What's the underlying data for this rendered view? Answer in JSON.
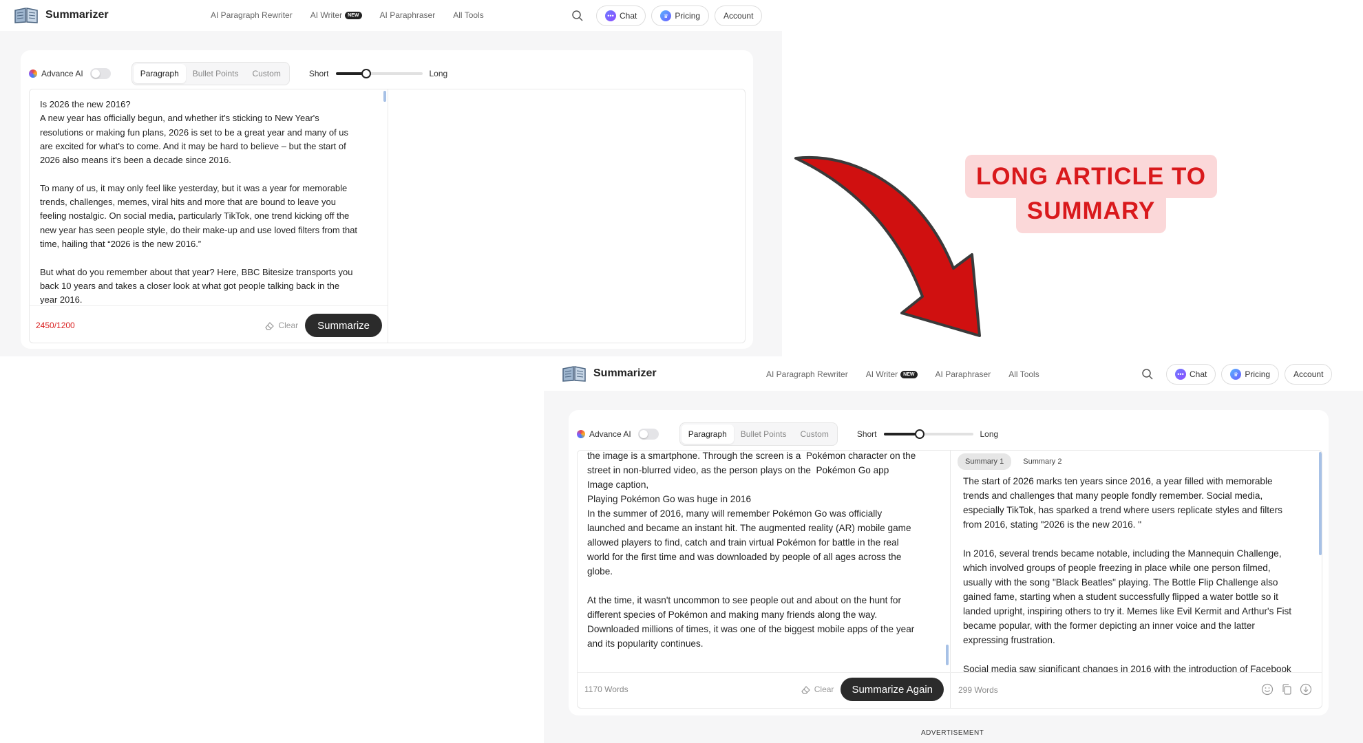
{
  "brand": {
    "name": "Summarizer"
  },
  "nav": {
    "links": [
      "AI Paragraph Rewriter",
      "AI Writer",
      "AI Paraphraser",
      "All Tools"
    ],
    "new_badge": "NEW",
    "chat": "Chat",
    "pricing": "Pricing",
    "account": "Account"
  },
  "toolbar": {
    "advance_ai": "Advance AI",
    "modes": [
      "Paragraph",
      "Bullet Points",
      "Custom"
    ],
    "short": "Short",
    "long": "Long"
  },
  "before": {
    "input_text": "Is 2026 the new 2016?\nA new year has officially begun, and whether it's sticking to New Year's\nresolutions or making fun plans, 2026 is set to be a great year and many of us\nare excited for what's to come. And it may be hard to believe – but the start of\n2026 also means it's been a decade since 2016.\n\nTo many of us, it may only feel like yesterday, but it was a year for memorable\ntrends, challenges, memes, viral hits and more that are bound to leave you\nfeeling nostalgic. On social media, particularly TikTok, one trend kicking off the\nnew year has seen people style, do their make-up and use loved filters from that\ntime, hailing that “2026 is the new 2016.”\n\nBut what do you remember about that year? Here, BBC Bitesize transports you\nback 10 years and takes a closer look at what got people talking back in the\nyear 2016.",
    "char_count": "2450/1200",
    "clear": "Clear",
    "summarize": "Summarize",
    "length_fraction": 0.35
  },
  "after": {
    "input_text": "the image is a smartphone. Through the screen is a  Pokémon character on the\nstreet in non-blurred video, as the person plays on the  Pokémon Go app\nImage caption,\nPlaying Pokémon Go was huge in 2016\nIn the summer of 2016, many will remember Pokémon Go was officially\nlaunched and became an instant hit. The augmented reality (AR) mobile game\nallowed players to find, catch and train virtual Pokémon for battle in the real\nworld for the first time and was downloaded by people of all ages across the\nglobe.\n\nAt the time, it wasn't uncommon to see people out and about on the hunt for\ndifferent species of Pokémon and making many friends along the way.\nDownloaded millions of times, it was one of the biggest mobile apps of the year\nand its popularity continues.",
    "word_count": "1170 Words",
    "clear": "Clear",
    "summarize_again": "Summarize Again",
    "summary_tabs": [
      "Summary 1",
      "Summary 2"
    ],
    "summary_text": "The start of 2026 marks ten years since 2016, a year filled with memorable\ntrends and challenges that many people fondly remember. Social media,\nespecially TikTok, has sparked a trend where users replicate styles and filters\nfrom 2016, stating \"2026 is the new 2016. \"\n\nIn 2016, several trends became notable, including the Mannequin Challenge,\nwhich involved groups of people freezing in place while one person filmed,\nusually with the song \"Black Beatles\" playing. The Bottle Flip Challenge also\ngained fame, starting when a student successfully flipped a water bottle so it\nlanded upright, inspiring others to try it. Memes like Evil Kermit and Arthur's Fist\nbecame popular, with the former depicting an inner voice and the latter\nexpressing frustration.\n\nSocial media saw significant changes in 2016 with the introduction of Facebook",
    "summary_word_count": "299 Words",
    "advertisement": "ADVERTISEMENT",
    "length_fraction": 0.4
  },
  "callout": {
    "line1": "LONG ARTICLE  TO",
    "line2": "SUMMARY"
  },
  "colors": {
    "accent_red": "#d9191c",
    "callout_bg": "#fbd8d9",
    "arrow": "#d01010"
  }
}
